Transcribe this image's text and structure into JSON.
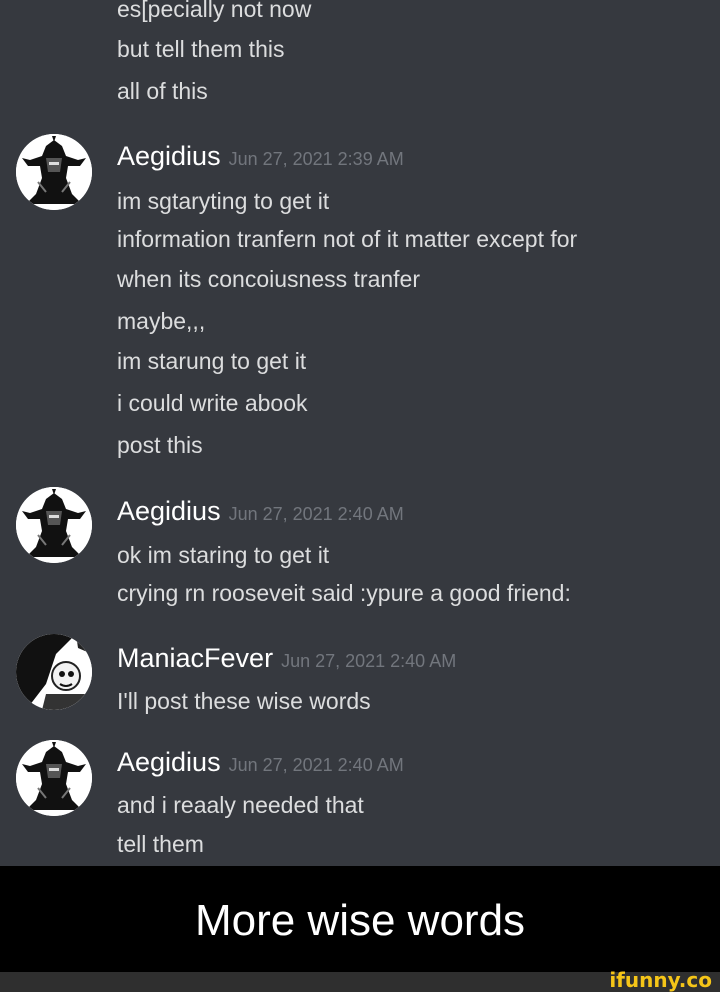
{
  "top_lines": [
    "es[pecially not now",
    "but tell them this",
    "all of this"
  ],
  "messages": [
    {
      "username": "Aegidius",
      "timestamp": "Jun 27, 2021 2:39 AM",
      "avatar_icon": "armored-knight-helmet-icon",
      "lines": [
        "im sgtaryting to get it",
        "information tranfern  not of it matter except for",
        "when its concoiusness tranfer",
        "maybe,,,",
        "im starung to get it",
        "i could write abook",
        "post this"
      ]
    },
    {
      "username": "Aegidius",
      "timestamp": "Jun 27, 2021 2:40 AM",
      "avatar_icon": "armored-knight-helmet-icon",
      "lines": [
        "ok im staring to get it",
        "crying rn rooseveit said :ypure a good friend:"
      ]
    },
    {
      "username": "ManiacFever",
      "timestamp": "Jun 27, 2021 2:40 AM",
      "avatar_icon": "anime-character-icon",
      "lines": [
        "I'll post these wise words"
      ]
    },
    {
      "username": "Aegidius",
      "timestamp": "Jun 27, 2021 2:40 AM",
      "avatar_icon": "armored-knight-helmet-icon",
      "lines": [
        "and i reaaly needed that",
        "tell them"
      ]
    }
  ],
  "caption": "More wise words",
  "watermark": "ifunny.co",
  "colors": {
    "chat_background": "#36393f",
    "message_text": "#dcddde",
    "username": "#ffffff",
    "timestamp": "#72767d",
    "caption_background": "#000000",
    "caption_text": "#ffffff",
    "watermark": "#f5c518"
  }
}
